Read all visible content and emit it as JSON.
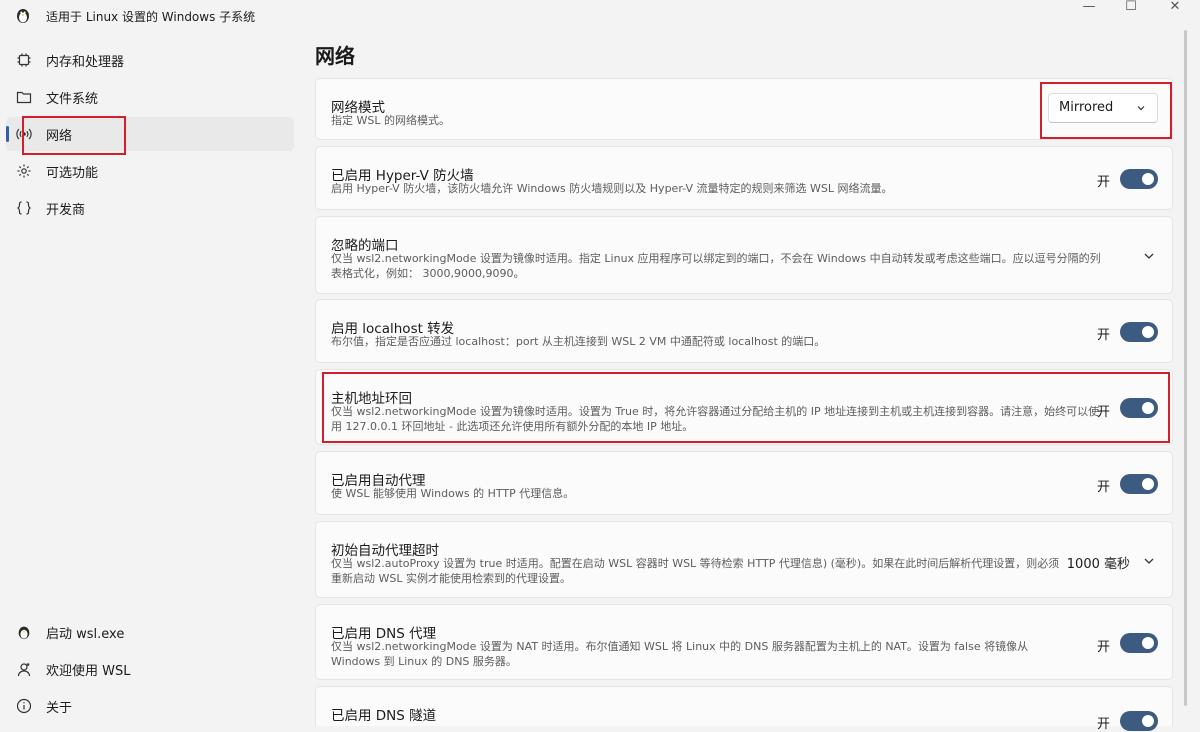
{
  "window": {
    "title": "适用于 Linux 设置的 Windows 子系统",
    "min_glyph": "—",
    "max_glyph": "☐",
    "close_glyph": "✕"
  },
  "sidebar": {
    "items": [
      {
        "label": "内存和处理器",
        "icon": "chip-icon"
      },
      {
        "label": "文件系统",
        "icon": "folder-icon"
      },
      {
        "label": "网络",
        "icon": "network-icon",
        "active": true
      },
      {
        "label": "可选功能",
        "icon": "gear-icon"
      },
      {
        "label": "开发商",
        "icon": "braces-icon"
      }
    ],
    "footer": [
      {
        "label": "启动 wsl.exe",
        "icon": "penguin-icon"
      },
      {
        "label": "欢迎使用 WSL",
        "icon": "welcome-icon"
      },
      {
        "label": "关于",
        "icon": "info-icon"
      }
    ]
  },
  "main": {
    "title": "网络",
    "settings": [
      {
        "title": "网络模式",
        "desc": "指定 WSL 的网络模式。",
        "dropdown_value": "Mirrored"
      },
      {
        "title": "已启用 Hyper-V 防火墙",
        "desc": "启用 Hyper-V 防火墙，该防火墙允许 Windows 防火墙规则以及 Hyper-V 流量特定的规则来筛选 WSL 网络流量。",
        "toggle_label": "开"
      },
      {
        "title": "忽略的端口",
        "desc": "仅当 wsl2.networkingMode 设置为镜像时适用。指定 Linux 应用程序可以绑定到的端口，不会在 Windows 中自动转发或考虑这些端口。应以逗号分隔的列表格式化，例如： 3000,9000,9090。"
      },
      {
        "title": "启用 localhost 转发",
        "desc": "布尔值，指定是否应通过 localhost：port 从主机连接到 WSL 2 VM 中通配符或 localhost 的端口。",
        "toggle_label": "开"
      },
      {
        "title": "主机地址环回",
        "desc": "仅当 wsl2.networkingMode 设置为镜像时适用。设置为 True 时，将允许容器通过分配给主机的 IP 地址连接到主机或主机连接到容器。请注意，始终可以使用 127.0.0.1 环回地址 - 此选项还允许使用所有额外分配的本地 IP 地址。",
        "toggle_label": "开"
      },
      {
        "title": "已启用自动代理",
        "desc": "使 WSL 能够使用 Windows 的 HTTP 代理信息。",
        "toggle_label": "开"
      },
      {
        "title": "初始自动代理超时",
        "desc": "仅当 wsl2.autoProxy 设置为 true 时适用。配置在启动 WSL 容器时 WSL 等待检索 HTTP 代理信息) (毫秒)。如果在此时间后解析代理设置，则必须重新启动 WSL 实例才能使用检索到的代理设置。",
        "value": "1000 毫秒"
      },
      {
        "title": "已启用 DNS 代理",
        "desc": "仅当 wsl2.networkingMode 设置为 NAT 时适用。布尔值通知 WSL 将 Linux 中的 DNS 服务器配置为主机上的 NAT。设置为 false 将镜像从 Windows 到 Linux 的 DNS 服务器。",
        "toggle_label": "开"
      },
      {
        "title": "已启用 DNS 隧道",
        "toggle_label": "开"
      }
    ]
  },
  "colors": {
    "accent": "#3d5a80",
    "highlight": "#d31f2b",
    "background": "#f3f3f3"
  }
}
